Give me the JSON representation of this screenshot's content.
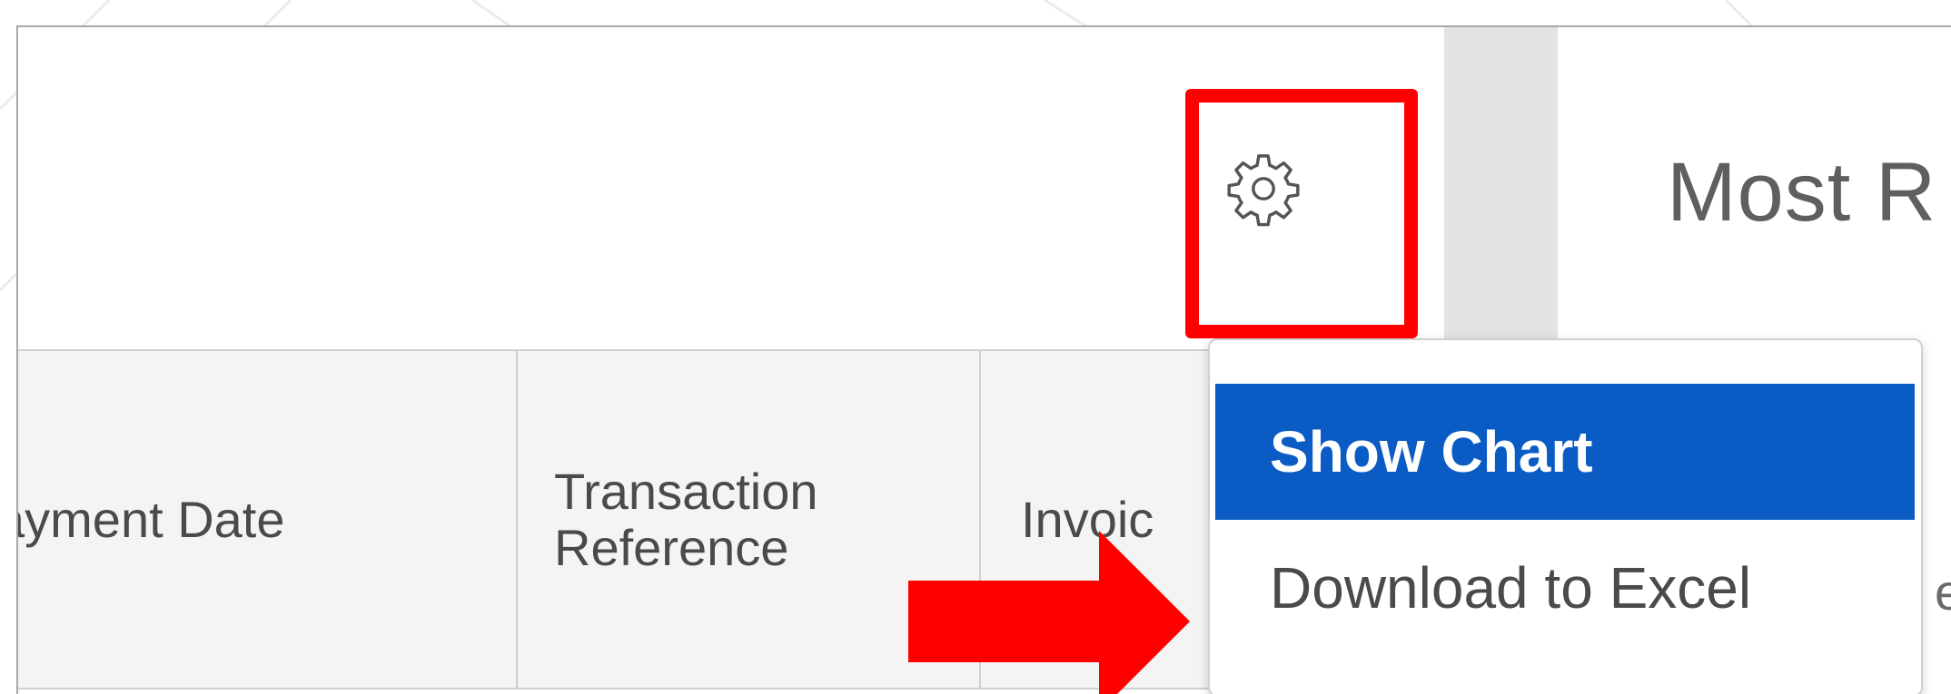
{
  "toolbar": {
    "settings_icon": "gear-icon"
  },
  "right_panel": {
    "title": "Most R"
  },
  "table": {
    "columns": [
      {
        "label": "ayment Date"
      },
      {
        "label": "Transaction Reference"
      },
      {
        "label": "Invoic"
      }
    ]
  },
  "menu": {
    "items": [
      {
        "label": "Show Chart",
        "selected": true
      },
      {
        "label": "Download to Excel",
        "selected": false
      }
    ],
    "trailing_text": "e"
  },
  "annotation": {
    "highlight_color": "#ff0000",
    "arrow_color": "#ff0000"
  },
  "colors": {
    "accent": "#0a5cc4"
  }
}
